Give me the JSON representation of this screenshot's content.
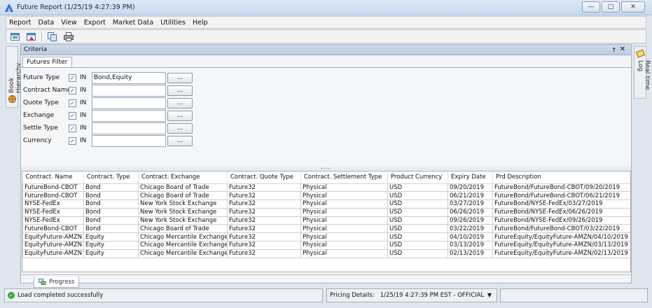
{
  "window": {
    "title": "Future Report (1/25/19 4:27:39 PM)"
  },
  "menu": [
    "Report",
    "Data",
    "View",
    "Export",
    "Market Data",
    "Utilities",
    "Help"
  ],
  "side": {
    "left_tab": "Book Hierarchy",
    "right_tab": "Real time Log"
  },
  "panel": {
    "title": "Criteria",
    "pin": "†",
    "close": "✕"
  },
  "tab": {
    "filter": "Futures Filter"
  },
  "filters": [
    {
      "label": "Future Type",
      "checked": true,
      "op": "IN",
      "value": "Bond,Equity"
    },
    {
      "label": "Contract Name",
      "checked": true,
      "op": "IN",
      "value": ""
    },
    {
      "label": "Quote Type",
      "checked": true,
      "op": "IN",
      "value": ""
    },
    {
      "label": "Exchange",
      "checked": true,
      "op": "IN",
      "value": ""
    },
    {
      "label": "Settle Type",
      "checked": true,
      "op": "IN",
      "value": ""
    },
    {
      "label": "Currency",
      "checked": true,
      "op": "IN",
      "value": ""
    }
  ],
  "dots_label": "...",
  "table": {
    "headers": [
      "Contract. Name",
      "Contract. Type",
      "Contract. Exchange",
      "Contract. Quote Type",
      "Contract. Settlement Type",
      "Product Currency",
      "Expiry Date",
      "Prd Description"
    ],
    "rows": [
      [
        "FutureBond-CBOT",
        "Bond",
        "Chicago Board of Trade",
        "Future32",
        "Physical",
        "USD",
        "09/20/2019",
        "FutureBond/FutureBond-CBOT/09/20/2019"
      ],
      [
        "FutureBond-CBOT",
        "Bond",
        "Chicago Board of Trade",
        "Future32",
        "Physical",
        "USD",
        "06/21/2019",
        "FutureBond/FutureBond-CBOT/06/21/2019"
      ],
      [
        "NYSE-FedEx",
        "Bond",
        "New York Stock Exchange",
        "Future32",
        "Physical",
        "USD",
        "03/27/2019",
        "FutureBond/NYSE-FedEx/03/27/2019"
      ],
      [
        "NYSE-FedEx",
        "Bond",
        "New York Stock Exchange",
        "Future32",
        "Physical",
        "USD",
        "06/26/2019",
        "FutureBond/NYSE-FedEx/06/26/2019"
      ],
      [
        "NYSE-FedEx",
        "Bond",
        "New York Stock Exchange",
        "Future32",
        "Physical",
        "USD",
        "09/26/2019",
        "FutureBond/NYSE-FedEx/09/26/2019"
      ],
      [
        "FutureBond-CBOT",
        "Bond",
        "Chicago Board of Trade",
        "Future32",
        "Physical",
        "USD",
        "03/22/2019",
        "FutureBond/FutureBond-CBOT/03/22/2019"
      ],
      [
        "EquityFuture-AMZN",
        "Equity",
        "Chicago Mercantile Exchange",
        "Future32",
        "Physical",
        "USD",
        "04/10/2019",
        "FutureEquity/EquityFuture-AMZN/04/10/2019"
      ],
      [
        "EquityFuture-AMZN",
        "Equity",
        "Chicago Mercantile Exchange",
        "Future32",
        "Physical",
        "USD",
        "03/13/2019",
        "FutureEquity/EquityFuture-AMZN/03/13/2019"
      ],
      [
        "EquityFuture-AMZN",
        "Equity",
        "Chicago Mercantile Exchange",
        "Future32",
        "Physical",
        "USD",
        "02/13/2019",
        "FutureEquity/EquityFuture-AMZN/02/13/2019"
      ]
    ]
  },
  "progress_tab": "Progress",
  "status": {
    "message": "Load completed successfully",
    "pricing_label": "Pricing Details:",
    "pricing_value": "1/25/19 4:27:39 PM EST - OFFICIAL"
  }
}
